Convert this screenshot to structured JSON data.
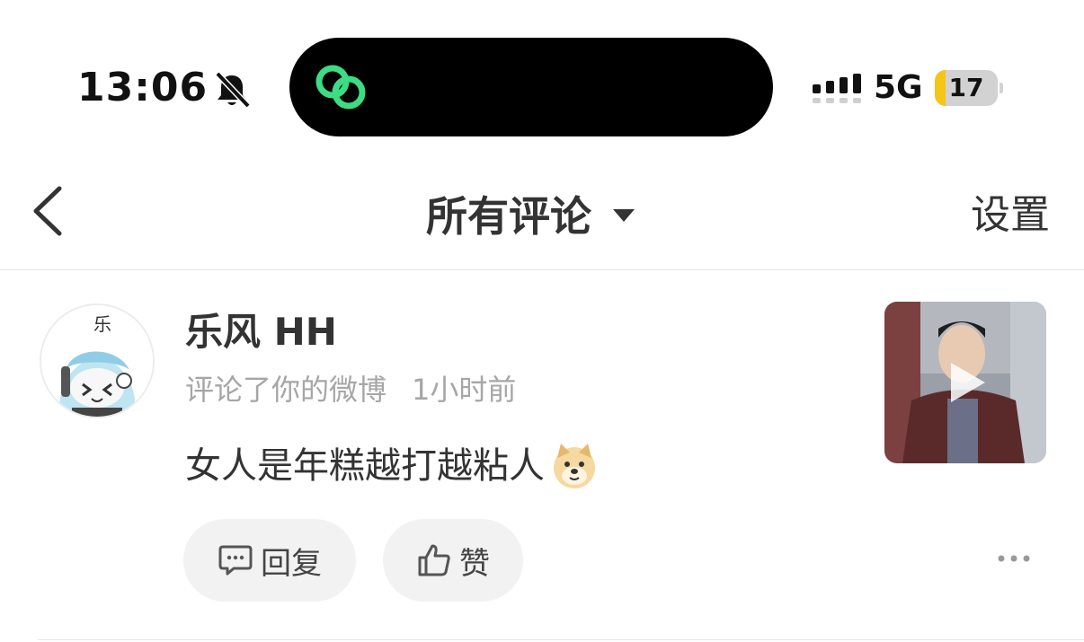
{
  "status_bar": {
    "time": "13:06",
    "network": "5G",
    "battery": "17",
    "battery_level": 0.17,
    "icons": [
      "bell-off-icon",
      "island-app-icon",
      "signal-icon"
    ],
    "accent_green": "#3ddc84",
    "battery_color": "#f5c518"
  },
  "nav": {
    "title": "所有评论",
    "settings_label": "设置",
    "icons": [
      "back-chevron-icon",
      "caret-down-icon"
    ]
  },
  "comment": {
    "avatar_text": "乐",
    "username": "乐风 HH",
    "action": "评论了你的微博",
    "time": "1小时前",
    "text": "女人是年糕越打越粘人",
    "emoji": "doge-emoji",
    "thumbnail_icon": "play-icon",
    "reply_label": "回复",
    "like_label": "赞",
    "icons": [
      "comment-icon",
      "thumb-up-icon",
      "more-icon"
    ]
  }
}
